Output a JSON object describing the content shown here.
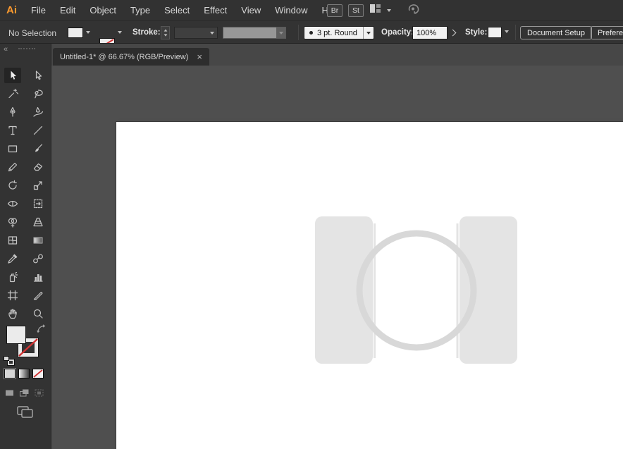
{
  "app": {
    "logo": "Ai"
  },
  "menubar": {
    "items": [
      "File",
      "Edit",
      "Object",
      "Type",
      "Select",
      "Effect",
      "View",
      "Window",
      "Help"
    ],
    "bridge_button": "Br",
    "stock_button": "St"
  },
  "controlbar": {
    "selection_status": "No Selection",
    "stroke_label": "Stroke:",
    "brush_value": "3 pt. Round",
    "opacity_label": "Opacity:",
    "opacity_value": "100%",
    "style_label": "Style:",
    "document_setup_button": "Document Setup",
    "preferences_button": "Preferences"
  },
  "document_tab": {
    "title": "Untitled-1* @ 66.67% (RGB/Preview)",
    "close_glyph": "×"
  },
  "toolbar": {
    "collapse_glyph": "«",
    "active_tool": "selection",
    "tools": [
      "selection",
      "direct-selection",
      "magic-wand",
      "lasso",
      "pen",
      "curvature",
      "type",
      "line-segment",
      "rectangle",
      "paintbrush",
      "shaper",
      "eraser",
      "rotate",
      "scale",
      "width",
      "free-transform",
      "shape-builder",
      "perspective-grid",
      "mesh",
      "gradient",
      "eyedropper",
      "blend",
      "symbol-sprayer",
      "column-graph",
      "artboard",
      "slice",
      "hand",
      "zoom"
    ],
    "fill_color": "#ebebeb",
    "stroke_style": "none"
  },
  "canvas": {
    "artboard_color": "#ffffff",
    "background": "#4f4f4f",
    "placeholder_color": "#e4e4e4"
  },
  "colors": {
    "bar_bg": "#323232",
    "accent_orange": "#ff9a2e",
    "none_red": "#d03434"
  }
}
